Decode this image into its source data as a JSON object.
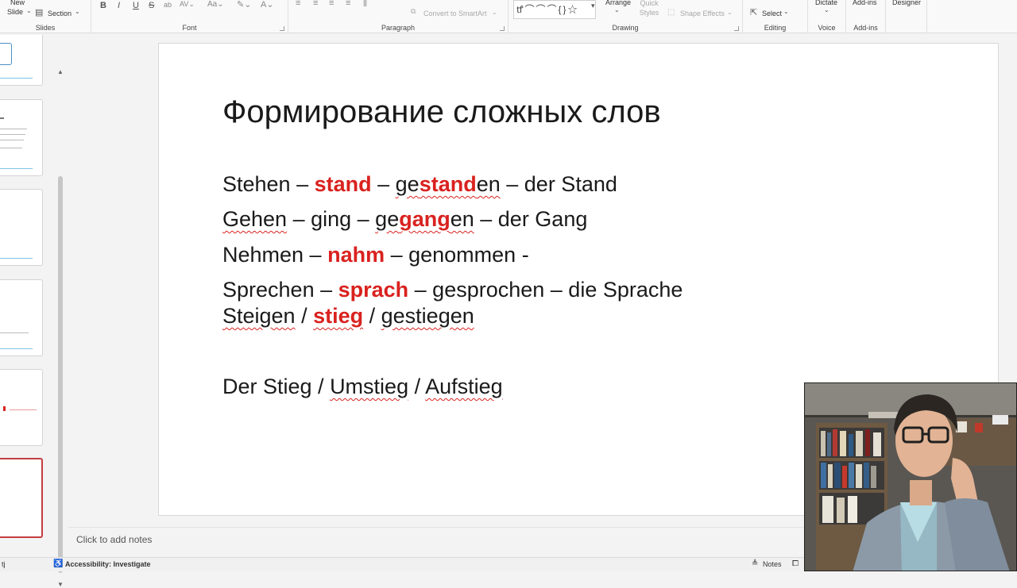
{
  "ribbon": {
    "slides_group": {
      "new_slide_label": "New",
      "slide_label": "Slide",
      "section_label": "Section",
      "group_label": "Slides"
    },
    "font_group": {
      "bold": "B",
      "italic": "I",
      "underline": "U",
      "strike": "S",
      "group_label": "Font"
    },
    "paragraph_group": {
      "convert_smartart": "Convert to SmartArt",
      "group_label": "Paragraph"
    },
    "drawing_group": {
      "arrange": "Arrange",
      "quick_styles": "Quick Styles",
      "shape_effects": "Shape Effects",
      "group_label": "Drawing"
    },
    "editing_group": {
      "select": "Select",
      "group_label": "Editing"
    },
    "voice_group": {
      "dictate": "Dictate",
      "group_label": "Voice"
    },
    "addins_group": {
      "addins": "Add-ins",
      "group_label": "Add-ins"
    },
    "designer": "Designer"
  },
  "slide": {
    "title": "Формирование сложных слов",
    "line1": {
      "a": "Stehen",
      "b": " – ",
      "c": "stand",
      "d": " – ",
      "e": "ge",
      "f": "stand",
      "g": "en",
      "h": " – der Stand"
    },
    "line2": {
      "a": "Gehen",
      "b": " – ging – ",
      "c": "ge",
      "d": "gang",
      "e": "en",
      "f": " – der Gang"
    },
    "line3": {
      "a": "Nehmen – ",
      "b": "nahm",
      "c": " – genommen -"
    },
    "line4": {
      "a": "Sprechen – ",
      "b": "sprach",
      "c": " – gesprochen – die Sprache"
    },
    "line5": {
      "a": "Steigen",
      "b": " / ",
      "c": "stieg",
      "d": " / ",
      "e": "gestiegen"
    },
    "line6": {
      "a": "Der Stieg / ",
      "b": "Umstieg",
      "c": " / ",
      "d": "Aufstieg"
    }
  },
  "notes": {
    "placeholder": "Click to add notes"
  },
  "status": {
    "slide_info": "tj",
    "accessibility": "Accessibility: Investigate",
    "notes_button": "Notes"
  },
  "colors": {
    "accent_red": "#d9221f",
    "selection_border": "#c43e3e"
  }
}
